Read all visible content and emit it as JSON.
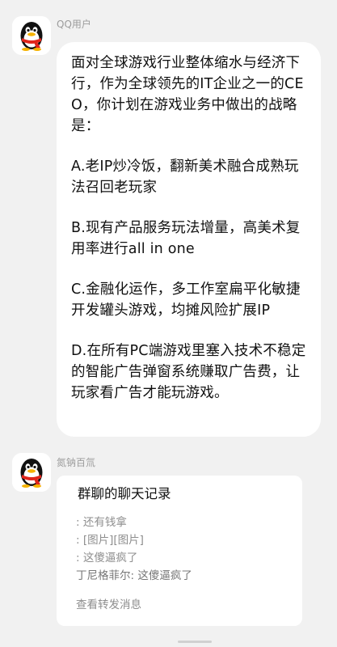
{
  "messages": [
    {
      "sender": "QQ用户",
      "avatar_icon": "qq-penguin-icon",
      "paragraphs": [
        "面对全球游戏行业整体缩水与经济下行，作为全球领先的IT企业之一的CEO，你计划在游戏业务中做出的战略是：",
        "A.老IP炒冷饭，翻新美术融合成熟玩法召回老玩家",
        "B.现有产品服务玩法增量，高美术复用率进行all in one",
        "C.金融化运作，多工作室扁平化敏捷开发罐头游戏，均摊风险扩展IP",
        "D.在所有PC端游戏里塞入技术不稳定的智能广告弹窗系统赚取广告费，让玩家看广告才能玩游戏。"
      ]
    },
    {
      "sender": "氮钠百氚",
      "avatar_icon": "qq-penguin-icon",
      "forward": {
        "title": "群聊的聊天记录",
        "lines": [
          ": 还有钱拿",
          ": [图片][图片]",
          ": 这傻逼疯了",
          "丁尼格菲尔: 这傻逼疯了"
        ],
        "footer": "查看转发消息"
      }
    }
  ],
  "colors": {
    "background": "#f1f1f1",
    "bubble": "#ffffff",
    "text": "#111111",
    "muted": "#8e8e8e",
    "penguin_scarf": "#e0251b",
    "penguin_beak": "#f5b200"
  }
}
